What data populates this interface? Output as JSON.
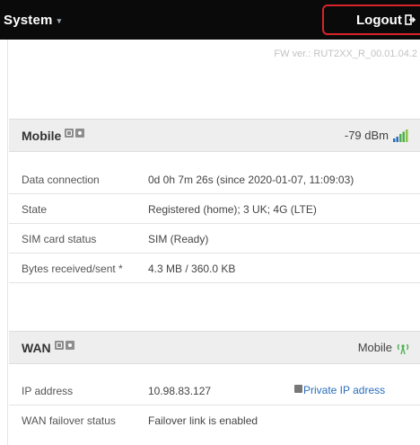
{
  "header": {
    "menu_label": "System",
    "menu_caret": "▾",
    "logout_label": "Logout"
  },
  "fw_version": "FW ver.: RUT2XX_R_00.01.04.2",
  "mobile": {
    "title": "Mobile",
    "signal_text": "-79 dBm",
    "rows": [
      {
        "label": "Data connection",
        "value": "0d 0h 7m 26s (since 2020-01-07, 11:09:03)"
      },
      {
        "label": "State",
        "value": "Registered (home); 3 UK; 4G (LTE)"
      },
      {
        "label": "SIM card status",
        "value": "SIM (Ready)"
      },
      {
        "label": "Bytes received/sent *",
        "value": "4.3 MB / 360.0 KB"
      }
    ]
  },
  "wan": {
    "title": "WAN",
    "type_text": "Mobile",
    "rows": [
      {
        "label": "IP address",
        "value": "10.98.83.127",
        "link": "Private IP adress"
      },
      {
        "label": "WAN failover status",
        "value": "Failover link is enabled"
      }
    ]
  },
  "colors": {
    "topbar": "#0a0a0a",
    "logout_border": "#d8232a",
    "link": "#2a6ebb",
    "signal_green": "#4caf50"
  },
  "icons": [
    "chevron-down-icon",
    "logout-icon",
    "info-icon",
    "settings-icon",
    "signal-bars-icon",
    "antenna-icon"
  ]
}
